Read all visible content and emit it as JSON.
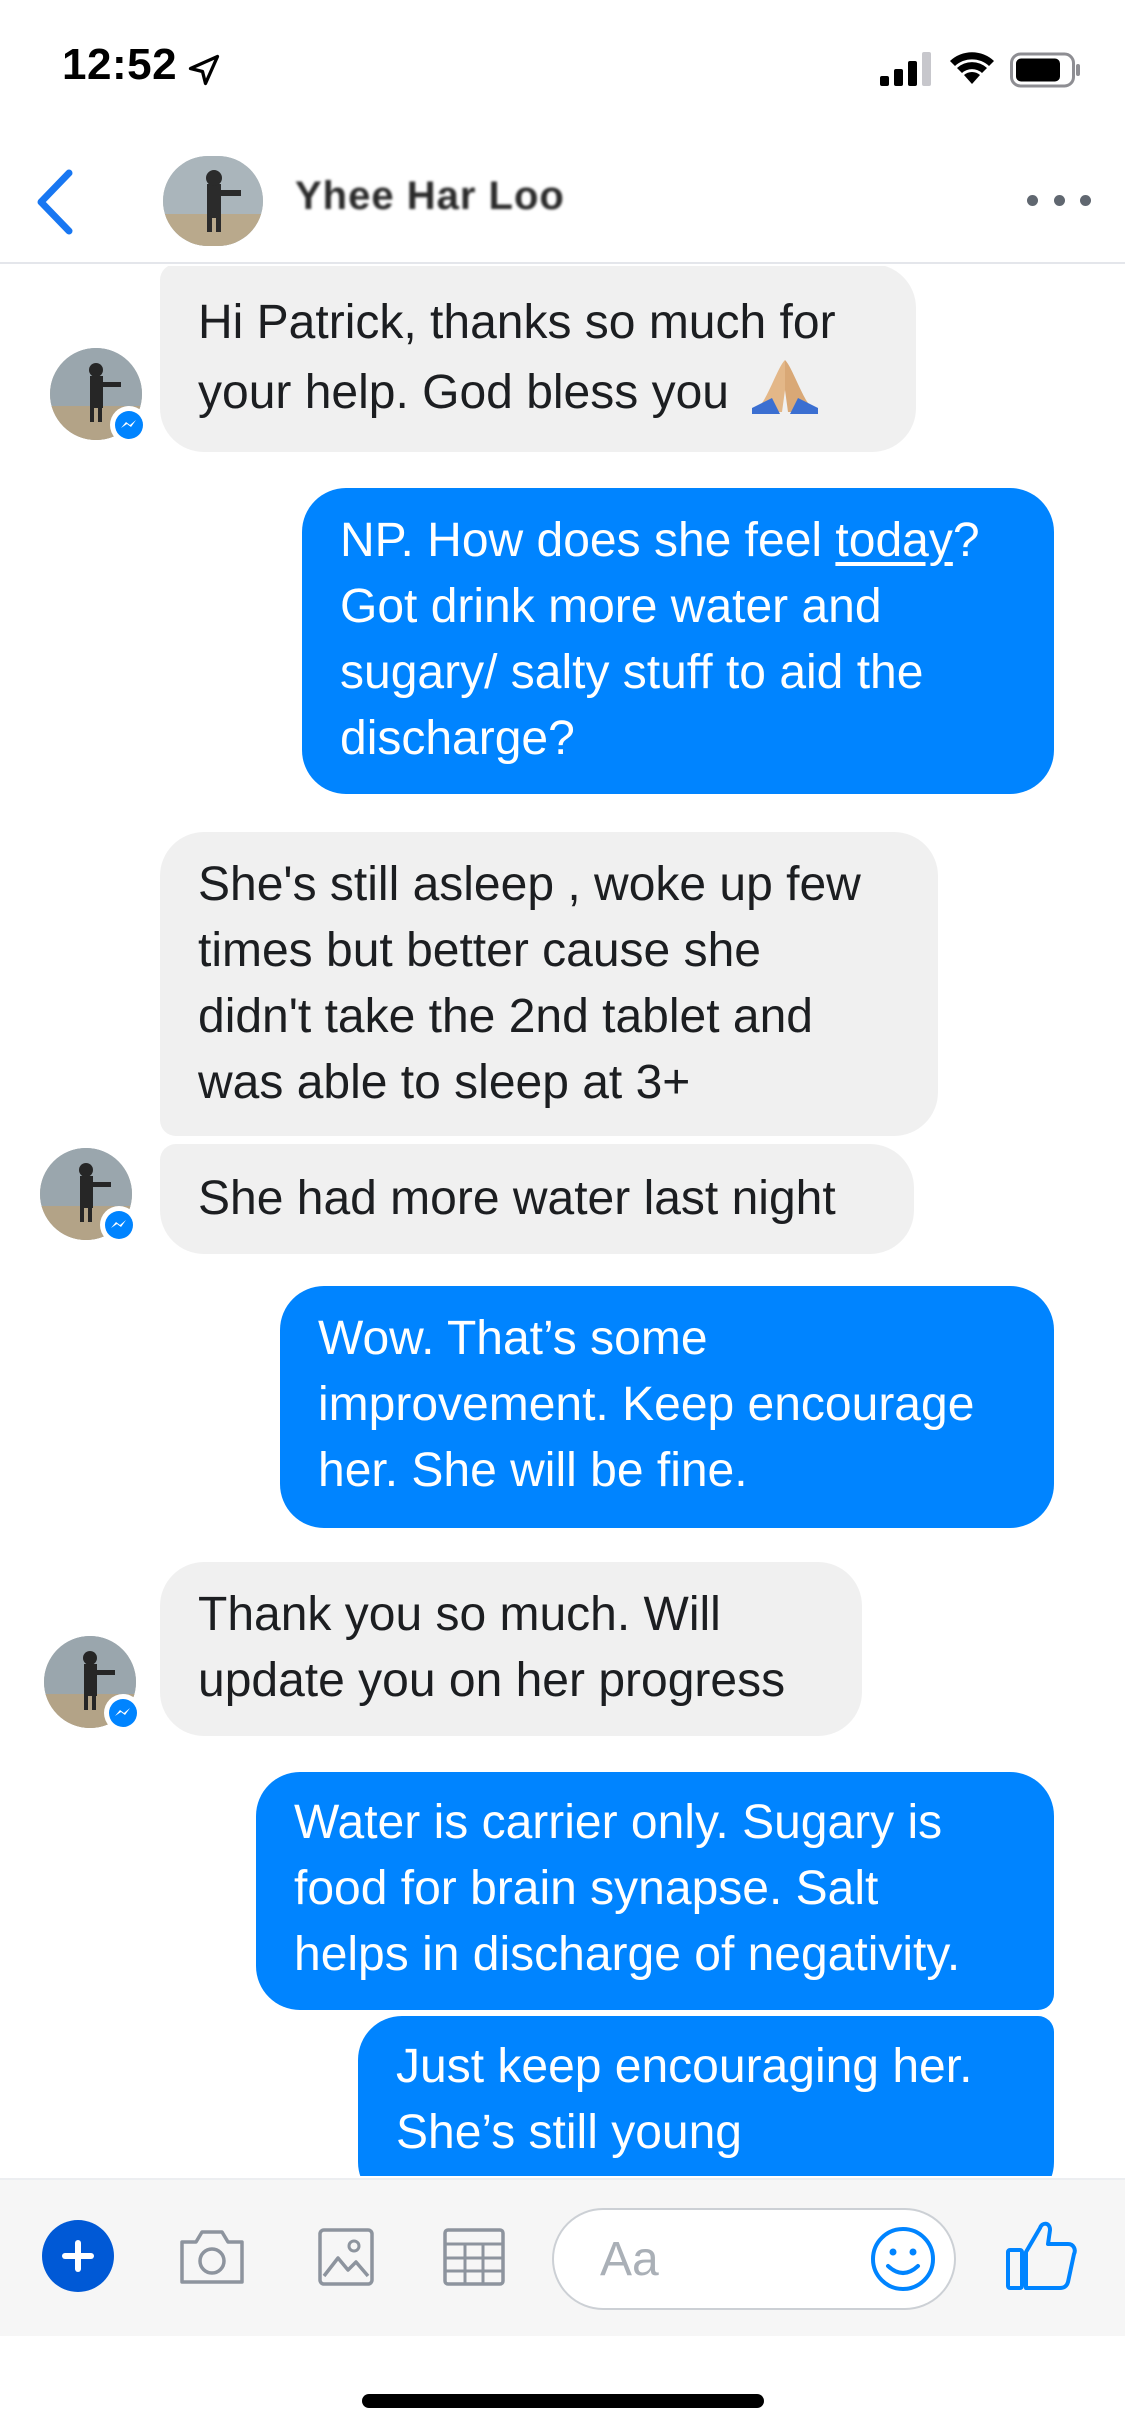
{
  "status_bar": {
    "time": "12:52"
  },
  "header": {
    "contact_name": "Yhee Har Loo"
  },
  "messages": [
    {
      "from": "them",
      "lines": [
        "Hi Patrick, thanks so much for",
        "your help. God bless you"
      ]
    },
    {
      "from": "me",
      "lines": [
        "NP. How does she feel ",
        "today",
        "?",
        "Got drink more water and",
        "sugary/ salty stuff to aid the",
        "discharge?"
      ]
    },
    {
      "from": "them",
      "lines": [
        "She's still asleep , woke up few",
        "times but better cause she",
        "didn't take the 2nd tablet and",
        "was able to sleep at 3+"
      ]
    },
    {
      "from": "them",
      "lines": [
        "She had more water last night"
      ]
    },
    {
      "from": "me",
      "lines": [
        "Wow. That’s some",
        "improvement. Keep encourage",
        "her. She will be fine."
      ]
    },
    {
      "from": "them",
      "lines": [
        "Thank you so much. Will",
        "update you on her progress"
      ]
    },
    {
      "from": "me",
      "lines": [
        "Water is carrier only. Sugary is",
        "food for brain synapse. Salt",
        "helps in discharge of negativity."
      ]
    },
    {
      "from": "me",
      "lines": [
        "Just keep encouraging her.",
        "She’s still young"
      ]
    }
  ],
  "composer": {
    "placeholder": "Aa"
  },
  "icons": {
    "back": "chevron-left-icon",
    "more": "more-horizontal-icon",
    "plus": "plus-icon",
    "camera": "camera-icon",
    "gallery": "image-icon",
    "gif": "grid-icon",
    "emoji": "smiley-icon",
    "like": "thumbs-up-icon",
    "badge": "messenger-badge-icon",
    "emoji_in_message": "folded-hands-emoji"
  },
  "colors": {
    "accent": "#0084ff",
    "incoming_bubble": "#f0f0f0",
    "plus_button": "#0059d6"
  }
}
